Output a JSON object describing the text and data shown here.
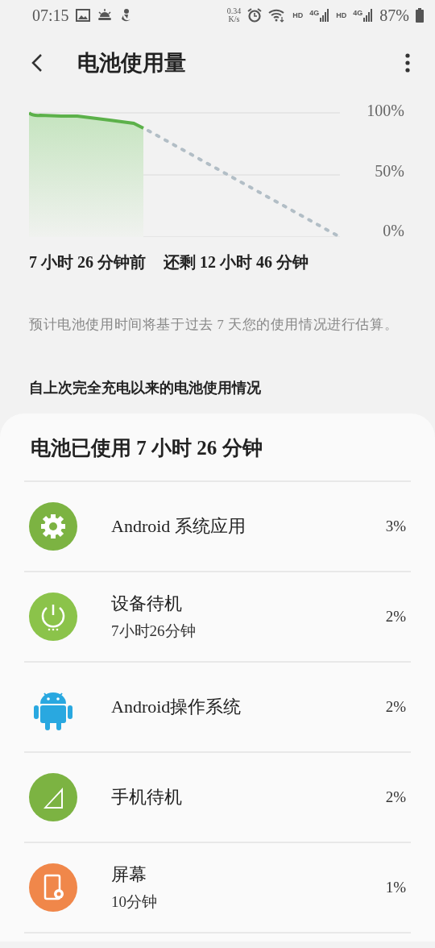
{
  "status_bar": {
    "time": "07:15",
    "speed_value": "0.34",
    "speed_unit": "K/s",
    "sim_1_label": "HD",
    "sim_1_network": "4G",
    "sim_2_label": "HD",
    "sim_2_network": "4G",
    "battery": "87%"
  },
  "header": {
    "title": "电池使用量"
  },
  "chart": {
    "y_labels": [
      "100%",
      "50%",
      "0%"
    ],
    "past_label": "7 小时 26 分钟前",
    "remaining_label": "还剩 12 小时 46 分钟"
  },
  "note": "预计电池使用时间将基于过去 7 天您的使用情况进行估算。",
  "section_title": "自上次完全充电以来的电池使用情况",
  "usage": {
    "title": "电池已使用 7 小时 26 分钟",
    "items": [
      {
        "kind": "gear",
        "color": "#7cb342",
        "name": "Android 系统应用",
        "percent": "3%"
      },
      {
        "kind": "power",
        "color": "#8bc34a",
        "name": "设备待机",
        "detail": "7小时26分钟",
        "percent": "2%"
      },
      {
        "kind": "android",
        "color": "#29a8e0",
        "name": "Android操作系统",
        "percent": "2%"
      },
      {
        "kind": "signal",
        "color": "#7cb342",
        "name": "手机待机",
        "percent": "2%"
      },
      {
        "kind": "screen",
        "color": "#f0874a",
        "name": "屏幕",
        "detail": "10分钟",
        "percent": "1%"
      }
    ]
  }
}
